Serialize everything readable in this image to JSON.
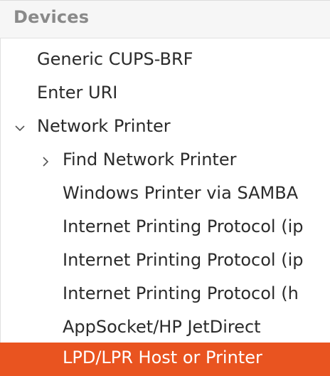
{
  "header": {
    "title": "Devices"
  },
  "tree": {
    "items": [
      {
        "label": "Generic CUPS-BRF"
      },
      {
        "label": "Enter URI"
      },
      {
        "label": "Network Printer",
        "expander": "chevron-down-icon"
      },
      {
        "label": "Find Network Printer",
        "expander": "chevron-right-icon"
      },
      {
        "label": "Windows Printer via SAMBA"
      },
      {
        "label": "Internet Printing Protocol (ip"
      },
      {
        "label": "Internet Printing Protocol (ip"
      },
      {
        "label": "Internet Printing Protocol (h"
      },
      {
        "label": "AppSocket/HP JetDirect"
      },
      {
        "label": "LPD/LPR Host or Printer",
        "selected": true
      }
    ]
  },
  "colors": {
    "selected_bg": "#e95420",
    "header_bg": "#f6f6f6",
    "header_text": "#8a8a8a",
    "text": "#2b2b2b"
  }
}
